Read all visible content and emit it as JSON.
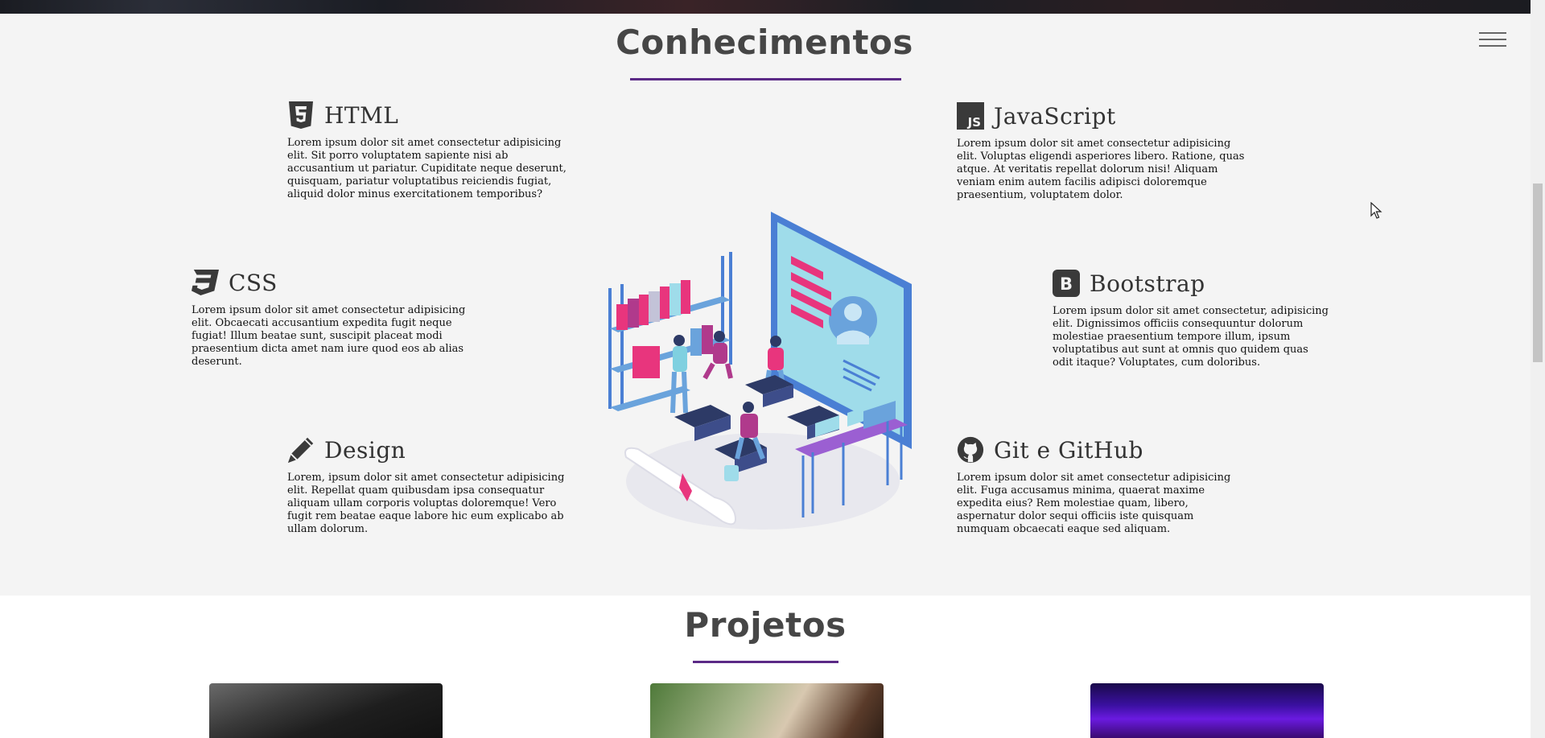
{
  "sections": {
    "skills_title": "Conhecimentos",
    "projects_title": "Projetos"
  },
  "colors": {
    "accent": "#5b2a86",
    "section_bg": "#f4f4f4",
    "heading": "#464646",
    "icon": "#3a3a3a"
  },
  "skills": [
    {
      "title": "HTML",
      "icon": "html5-icon",
      "text": "Lorem ipsum dolor sit amet consectetur adipisicing elit. Sit porro voluptatem sapiente nisi ab accusantium ut pariatur. Cupiditate neque deserunt, quisquam, pariatur voluptatibus reiciendis fugiat, aliquid dolor minus exercitationem temporibus?"
    },
    {
      "title": "JavaScript",
      "icon": "js-icon",
      "icon_text": "JS",
      "text": "Lorem ipsum dolor sit amet consectetur adipisicing elit. Voluptas eligendi asperiores libero. Ratione, quas atque. At veritatis repellat dolorum nisi! Aliquam veniam enim autem facilis adipisci doloremque praesentium, voluptatem dolor."
    },
    {
      "title": "CSS",
      "icon": "css3-icon",
      "text": "Lorem ipsum dolor sit amet consectetur adipisicing elit. Obcaecati accusantium expedita fugit neque fugiat! Illum beatae sunt, suscipit placeat modi praesentium dicta amet nam iure quod eos ab alias deserunt."
    },
    {
      "title": "Bootstrap",
      "icon": "bootstrap-icon",
      "icon_text": "B",
      "text": "Lorem ipsum dolor sit amet consectetur, adipisicing elit. Dignissimos officiis consequuntur dolorum molestiae praesentium tempore illum, ipsum voluptatibus aut sunt at omnis quo quidem quas odit itaque? Voluptates, cum doloribus."
    },
    {
      "title": "Design",
      "icon": "pencil-icon",
      "text": "Lorem, ipsum dolor sit amet consectetur adipisicing elit. Repellat quam quibusdam ipsa consequatur aliquam ullam corporis voluptas doloremque! Vero fugit rem beatae eaque labore hic eum explicabo ab ullam dolorum."
    },
    {
      "title": "Git e GitHub",
      "icon": "github-icon",
      "text": "Lorem ipsum dolor sit amet consectetur adipisicing elit. Fuga accusamus minima, quaerat maxime expedita eius? Rem molestiae quam, libero, aspernatur dolor sequi officiis iste quisquam numquam obcaecati eaque sed aliquam."
    }
  ],
  "icons": {
    "menu": "hamburger-menu-icon",
    "cursor": "mouse-pointer-icon"
  }
}
